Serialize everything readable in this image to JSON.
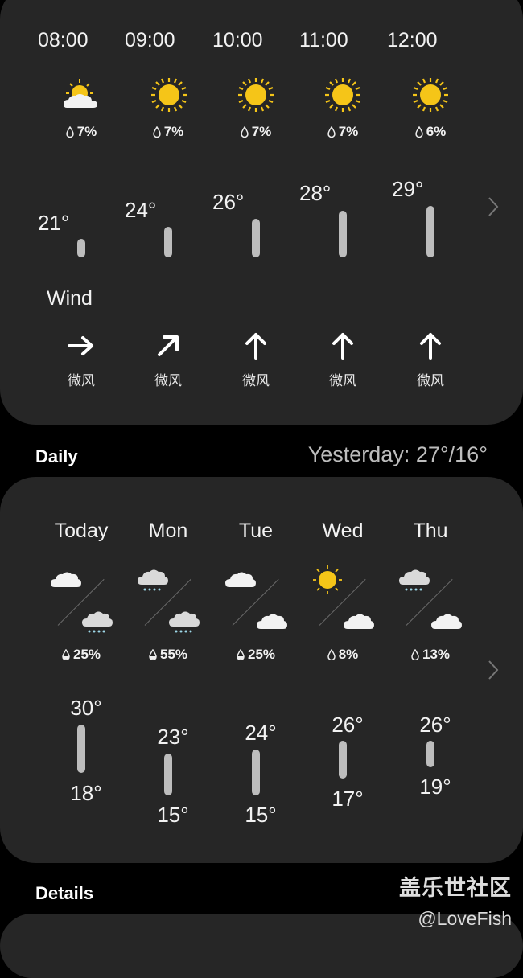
{
  "hourly": {
    "items": [
      {
        "time": "08:00",
        "icon": "partly-sunny-icon",
        "precip": "7%",
        "temp": "21°",
        "wind_dir": "right",
        "wind": "微风"
      },
      {
        "time": "09:00",
        "icon": "sun-icon",
        "precip": "7%",
        "temp": "24°",
        "wind_dir": "up-right",
        "wind": "微风"
      },
      {
        "time": "10:00",
        "icon": "sun-icon",
        "precip": "7%",
        "temp": "26°",
        "wind_dir": "up",
        "wind": "微风"
      },
      {
        "time": "11:00",
        "icon": "sun-icon",
        "precip": "7%",
        "temp": "28°",
        "wind_dir": "up",
        "wind": "微风"
      },
      {
        "time": "12:00",
        "icon": "sun-icon",
        "precip": "6%",
        "temp": "29°",
        "wind_dir": "up",
        "wind": "微风"
      }
    ],
    "wind_title": "Wind"
  },
  "daily": {
    "title": "Daily",
    "yesterday": "Yesterday: 27°/16°",
    "items": [
      {
        "day": "Today",
        "day_icon": "cloud-icon",
        "night_icon": "rain-cloud-icon",
        "precip": "25%",
        "high": "30°",
        "low": "18°"
      },
      {
        "day": "Mon",
        "day_icon": "rain-cloud-icon",
        "night_icon": "rain-cloud-icon",
        "precip": "55%",
        "high": "23°",
        "low": "15°"
      },
      {
        "day": "Tue",
        "day_icon": "cloud-icon",
        "night_icon": "cloud-icon",
        "precip": "25%",
        "high": "24°",
        "low": "15°"
      },
      {
        "day": "Wed",
        "day_icon": "sun-icon",
        "night_icon": "cloud-icon",
        "precip": "8%",
        "high": "26°",
        "low": "17°"
      },
      {
        "day": "Thu",
        "day_icon": "rain-cloud-icon",
        "night_icon": "cloud-icon",
        "precip": "13%",
        "high": "26°",
        "low": "19°"
      }
    ]
  },
  "details": {
    "title": "Details"
  },
  "watermark": {
    "line1": "盖乐世社区",
    "line2": "@LoveFish"
  },
  "colors": {
    "background": "#000000",
    "card": "#262626",
    "bar": "#bdbdbd",
    "sun": "#f5c518"
  }
}
